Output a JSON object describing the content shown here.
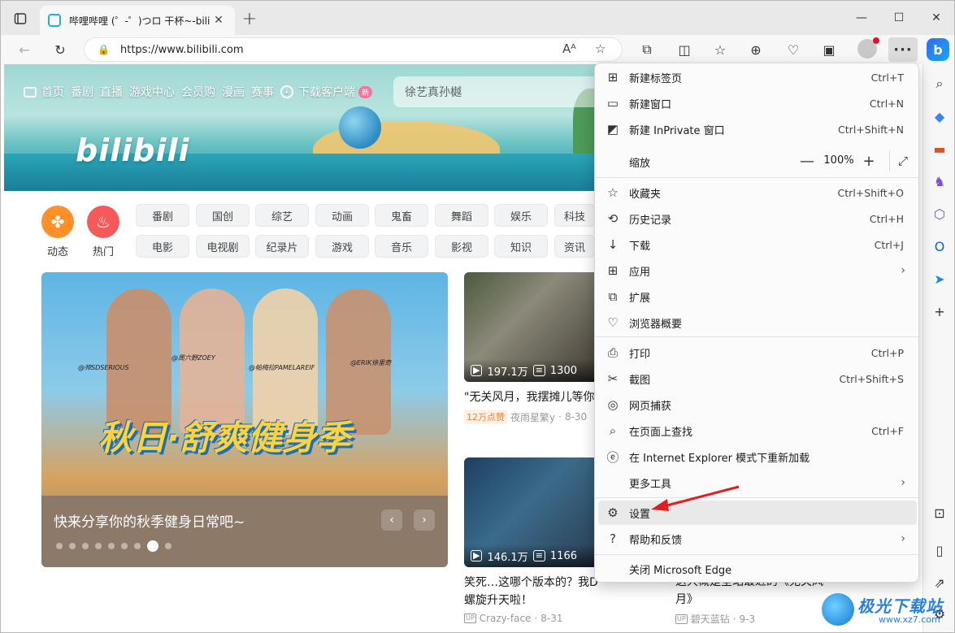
{
  "browser": {
    "tab_title": "哔哩哔哩 (゜-゜)つロ 干杯~-bilibili",
    "url": "https://www.bilibili.com",
    "profile_color": "#c9c9c9",
    "accent": "#e81123"
  },
  "site": {
    "nav": [
      "首页",
      "番剧",
      "直播",
      "游戏中心",
      "会员购",
      "漫画",
      "赛事"
    ],
    "download": "下载客户端",
    "new_badge": "新",
    "logo": "bilibili",
    "search_placeholder": "徐艺真孙樾",
    "circles": [
      {
        "label": "动态",
        "icon": "pinwheel-icon",
        "color": "#ff8f26"
      },
      {
        "label": "热门",
        "icon": "flame-icon",
        "color": "#f45a5a"
      }
    ],
    "chips_row1": [
      "番剧",
      "国创",
      "综艺",
      "动画",
      "鬼畜",
      "舞蹈",
      "娱乐",
      "科技"
    ],
    "chips_row2": [
      "电影",
      "电视剧",
      "纪录片",
      "游戏",
      "音乐",
      "影视",
      "知识",
      "资讯"
    ],
    "carousel": {
      "poster_text": "秋日·舒爽健身季",
      "name_tags": [
        "@帅SDSERIOUS",
        "@周六野ZOEY",
        "@帕梅拉PAMELAREIF",
        "@ERIK徐里奇"
      ],
      "caption": "快来分享你的秋季健身日常吧~",
      "dot_count": 9,
      "active_dot": 8
    },
    "cards": [
      {
        "views": "197.1万",
        "danmaku": "1300",
        "title": "\"无关风月，我摆摊儿等你",
        "badge": "12万点赞",
        "author": "夜雨星繁y",
        "date": "8-30"
      },
      {
        "views": "146.1万",
        "danmaku": "1166",
        "title": "笑死…这哪个版本的？我DNA都",
        "title2": "螺旋升天啦！",
        "author": "Crazy-face",
        "date": "8-31"
      }
    ],
    "card3_partial": {
      "title": "这大概是全站最近的《无关风",
      "title2": "月》",
      "author": "碧天蓝钻",
      "date": "9-3"
    }
  },
  "menu": {
    "items": [
      {
        "label": "新建标签页",
        "shortcut": "Ctrl+T",
        "icon": "new-tab-icon"
      },
      {
        "label": "新建窗口",
        "shortcut": "Ctrl+N",
        "icon": "new-window-icon"
      },
      {
        "label": "新建 InPrivate 窗口",
        "shortcut": "Ctrl+Shift+N",
        "icon": "inprivate-icon"
      },
      {
        "label": "收藏夹",
        "shortcut": "Ctrl+Shift+O",
        "icon": "favorites-icon"
      },
      {
        "label": "历史记录",
        "shortcut": "Ctrl+H",
        "icon": "history-icon"
      },
      {
        "label": "下载",
        "shortcut": "Ctrl+J",
        "icon": "download-icon"
      },
      {
        "label": "应用",
        "shortcut": "",
        "icon": "apps-icon"
      },
      {
        "label": "扩展",
        "shortcut": "",
        "icon": "extensions-icon"
      },
      {
        "label": "浏览器概要",
        "shortcut": "",
        "icon": "browser-essentials-icon"
      },
      {
        "label": "打印",
        "shortcut": "Ctrl+P",
        "icon": "print-icon"
      },
      {
        "label": "截图",
        "shortcut": "Ctrl+Shift+S",
        "icon": "screenshot-icon"
      },
      {
        "label": "网页捕获",
        "shortcut": "",
        "icon": "web-capture-icon"
      },
      {
        "label": "在页面上查找",
        "shortcut": "Ctrl+F",
        "icon": "find-icon"
      },
      {
        "label": "在 Internet Explorer 模式下重新加载",
        "shortcut": "",
        "icon": "ie-mode-icon"
      },
      {
        "label": "更多工具",
        "shortcut": "",
        "icon": ""
      },
      {
        "label": "设置",
        "shortcut": "",
        "icon": "gear-icon"
      },
      {
        "label": "帮助和反馈",
        "shortcut": "",
        "icon": "help-icon"
      },
      {
        "label": "关闭 Microsoft Edge",
        "shortcut": "",
        "icon": ""
      }
    ],
    "zoom_label": "缩放",
    "zoom_value": "100%",
    "zoom_minus": "—",
    "zoom_plus": "+"
  },
  "watermark": {
    "text": "极光下载站",
    "url": "www.xz7.com"
  }
}
